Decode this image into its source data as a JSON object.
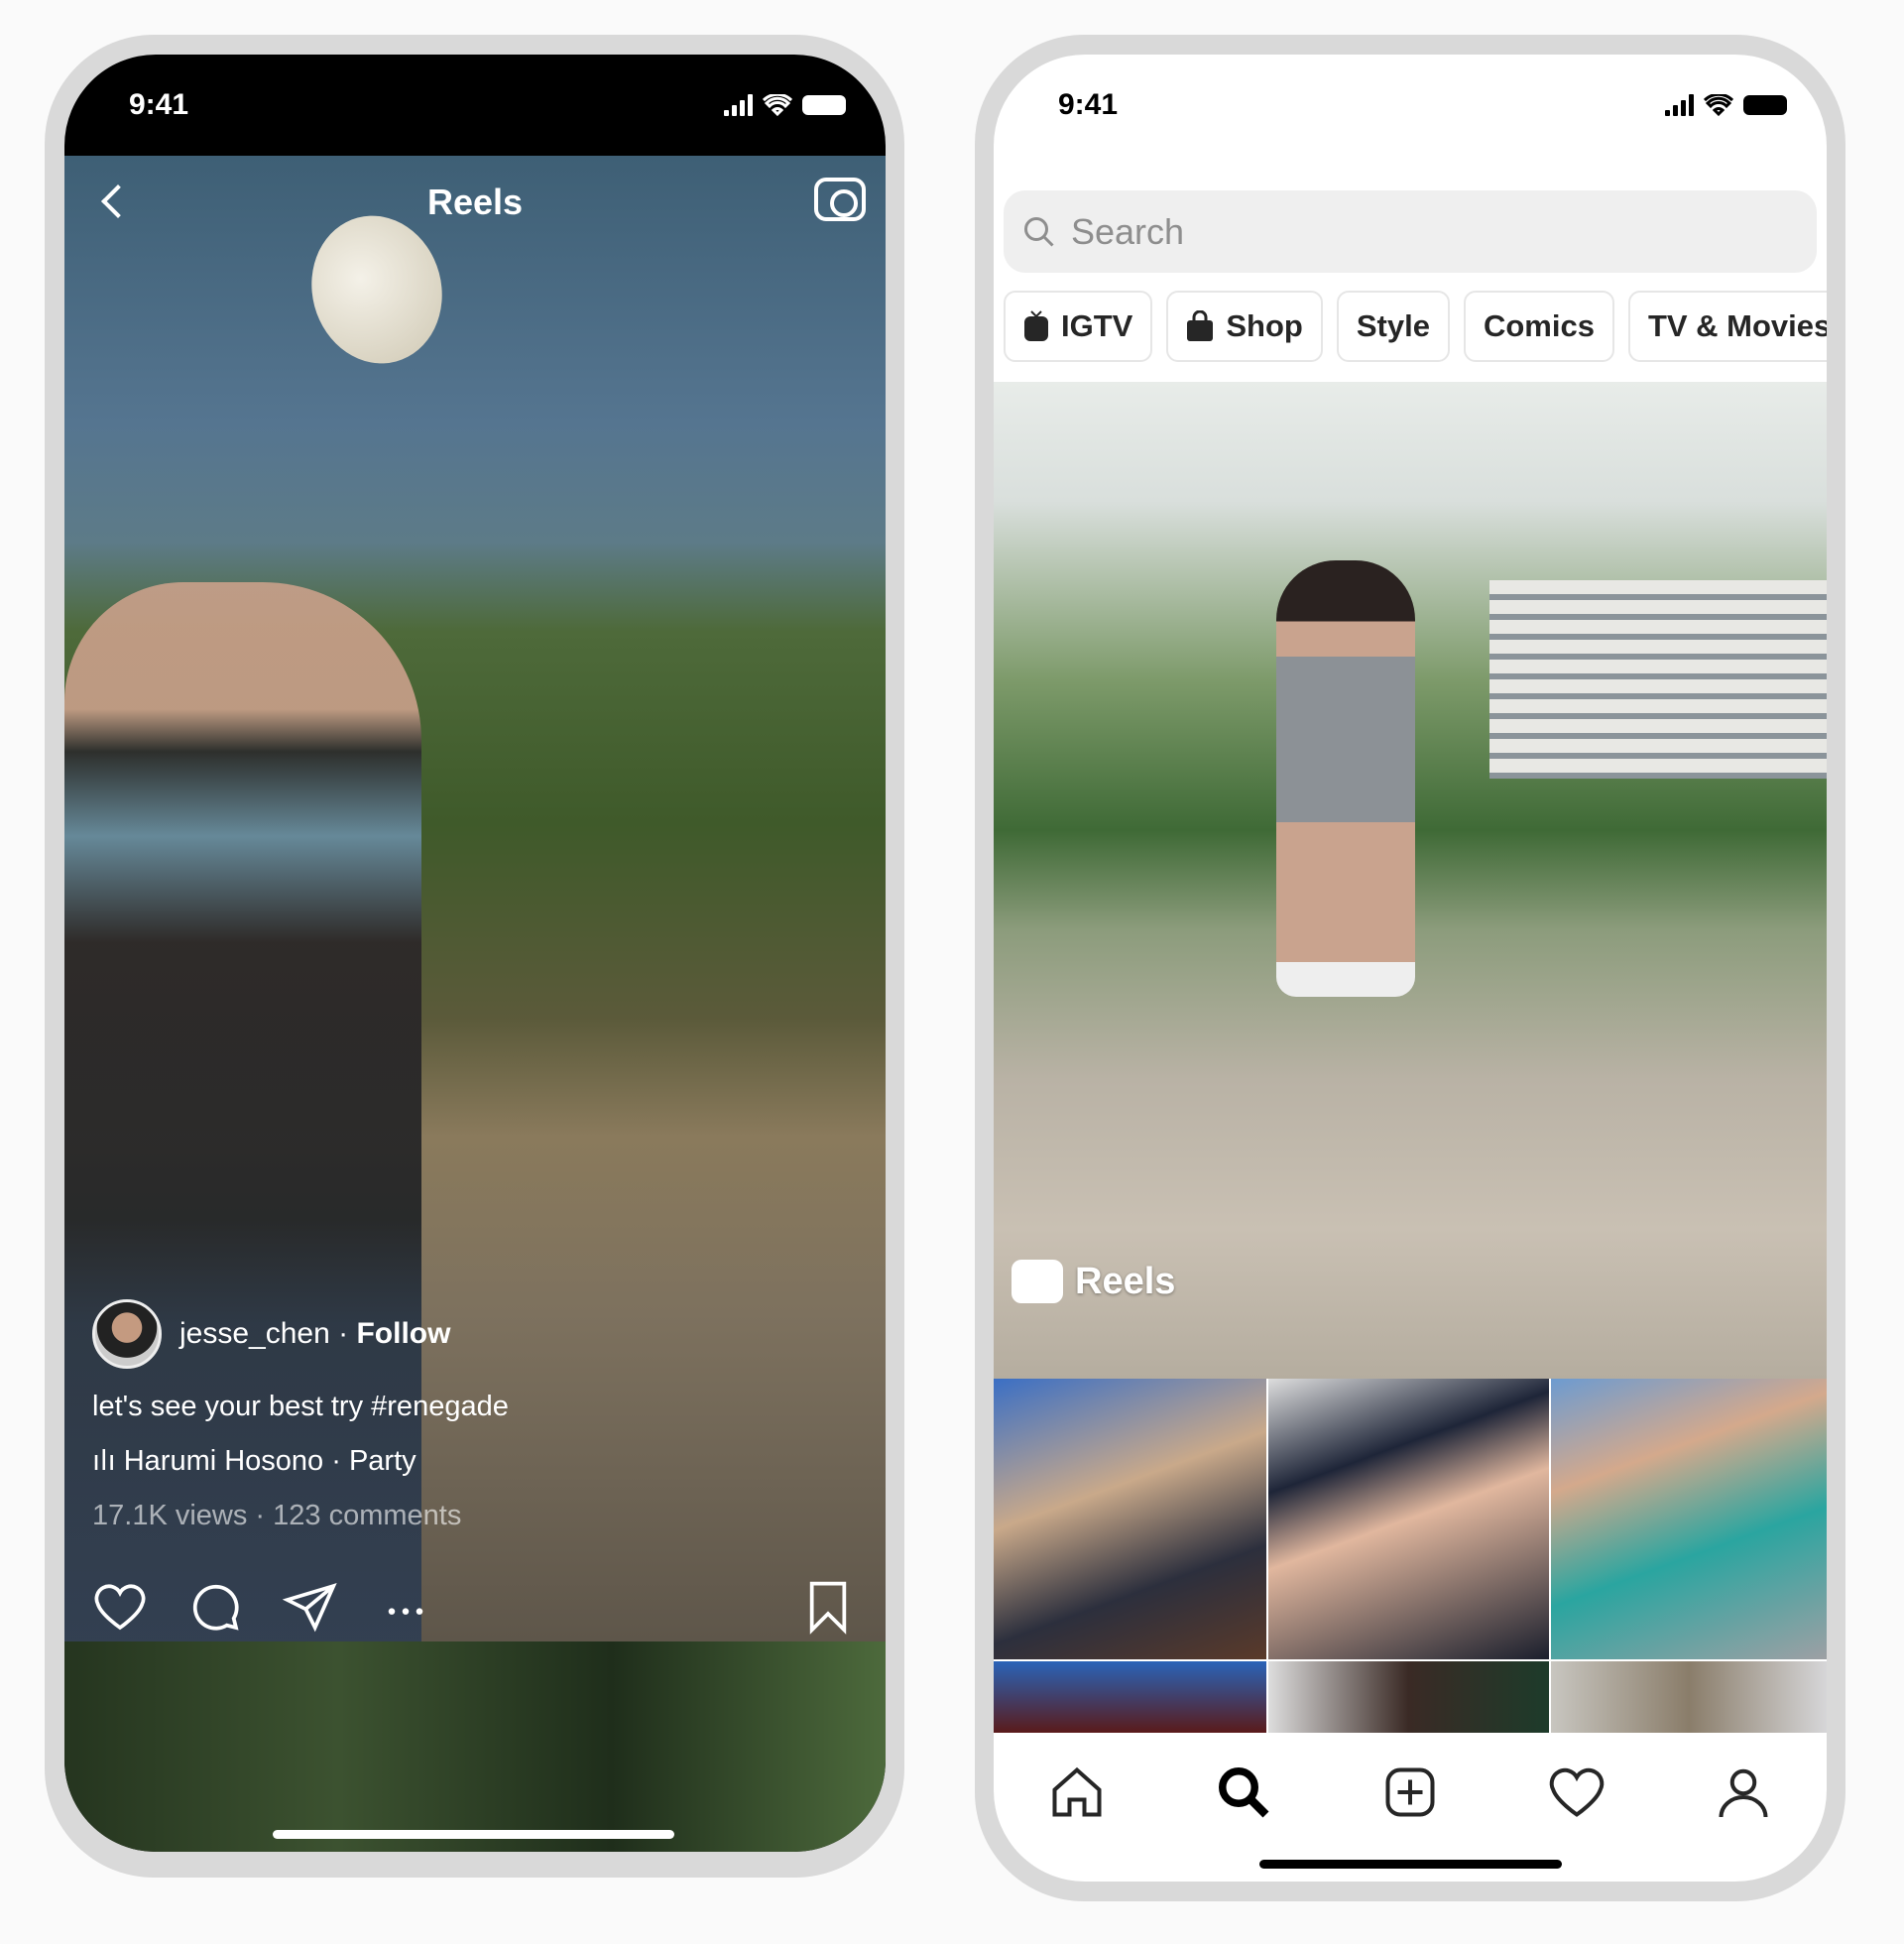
{
  "left_phone": {
    "status_time": "9:41",
    "header": {
      "title": "Reels"
    },
    "post": {
      "username": "jesse_chen",
      "separator": " · ",
      "follow_label": "Follow",
      "caption": "let's see your best try #renegade",
      "audio": "Harumi Hosono · Party",
      "stats": "17.1K views · 123 comments"
    },
    "icons": [
      "back-chevron-icon",
      "camera-icon",
      "heart-icon",
      "comment-icon",
      "share-icon",
      "more-icon",
      "bookmark-icon"
    ]
  },
  "right_phone": {
    "status_time": "9:41",
    "search": {
      "placeholder": "Search"
    },
    "chips": [
      {
        "label": "IGTV",
        "icon": "igtv-icon"
      },
      {
        "label": "Shop",
        "icon": "shopping-bag-icon"
      },
      {
        "label": "Style"
      },
      {
        "label": "Comics"
      },
      {
        "label": "TV & Movies"
      }
    ],
    "featured_label": "Reels",
    "nav": [
      "home",
      "search",
      "add-post",
      "activity",
      "profile"
    ],
    "active_nav": "search"
  }
}
